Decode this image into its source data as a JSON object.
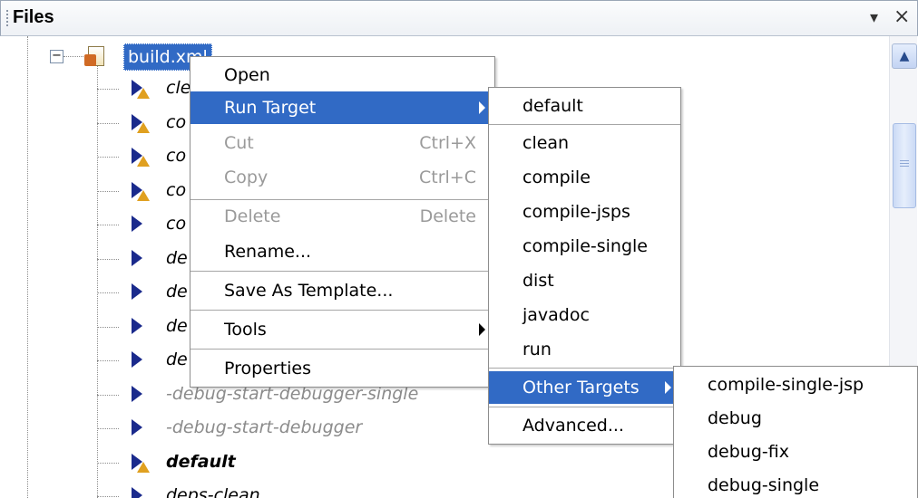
{
  "panel": {
    "title": "Files"
  },
  "tree": {
    "root": {
      "label": "build.xml"
    },
    "items": [
      {
        "label": "cle",
        "warn": true,
        "style": "normal"
      },
      {
        "label": "co",
        "warn": true,
        "style": "normal"
      },
      {
        "label": "co",
        "warn": true,
        "style": "normal"
      },
      {
        "label": "co",
        "warn": true,
        "style": "normal"
      },
      {
        "label": "co",
        "warn": false,
        "style": "normal"
      },
      {
        "label": "de",
        "warn": false,
        "style": "normal"
      },
      {
        "label": "de",
        "warn": false,
        "style": "normal"
      },
      {
        "label": "de",
        "warn": false,
        "style": "normal"
      },
      {
        "label": "de",
        "warn": false,
        "style": "normal"
      },
      {
        "label": "-debug-start-debugger-single",
        "warn": false,
        "style": "gray"
      },
      {
        "label": "-debug-start-debugger",
        "warn": false,
        "style": "gray"
      },
      {
        "label": "default",
        "warn": true,
        "style": "bold"
      },
      {
        "label": "deps-clean",
        "warn": false,
        "style": "normal"
      }
    ]
  },
  "context_menu": {
    "open": "Open",
    "run_target": "Run Target",
    "cut": "Cut",
    "cut_shortcut": "Ctrl+X",
    "copy": "Copy",
    "copy_shortcut": "Ctrl+C",
    "delete": "Delete",
    "delete_shortcut": "Delete",
    "rename": "Rename...",
    "save_as_template": "Save As Template...",
    "tools": "Tools",
    "properties": "Properties"
  },
  "run_target_menu": {
    "default": "default",
    "items": [
      "clean",
      "compile",
      "compile-jsps",
      "compile-single",
      "dist",
      "javadoc",
      "run"
    ],
    "other_targets": "Other Targets",
    "advanced": "Advanced..."
  },
  "other_targets_menu": {
    "items": [
      "compile-single-jsp",
      "debug",
      "debug-fix",
      "debug-single"
    ]
  },
  "colors": {
    "selection": "#316ac5",
    "disabled_text": "#9a9a9a",
    "target_icon": "#1a2a8c",
    "warning_icon": "#e0a020"
  }
}
